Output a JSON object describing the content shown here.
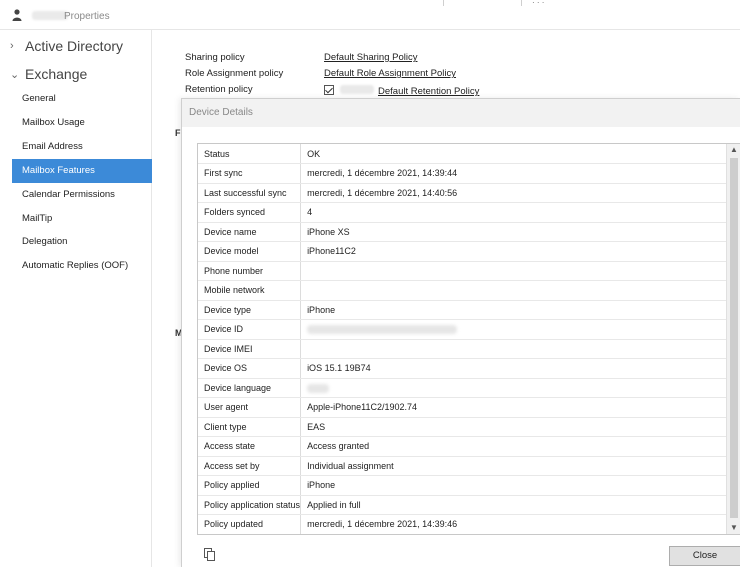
{
  "window": {
    "title": "Properties",
    "dots": "· · ·"
  },
  "nav": {
    "groups": [
      {
        "label": "Active Directory",
        "expanded": false
      },
      {
        "label": "Exchange",
        "expanded": true
      }
    ],
    "items": [
      {
        "label": "General"
      },
      {
        "label": "Mailbox Usage"
      },
      {
        "label": "Email Address"
      },
      {
        "label": "Mailbox Features",
        "selected": true
      },
      {
        "label": "Calendar Permissions"
      },
      {
        "label": "MailTip"
      },
      {
        "label": "Delegation"
      },
      {
        "label": "Automatic Replies (OOF)"
      }
    ]
  },
  "policies": {
    "sharing": {
      "label": "Sharing policy",
      "value": "Default Sharing Policy"
    },
    "role": {
      "label": "Role Assignment policy",
      "value": "Default Role Assignment Policy"
    },
    "retention": {
      "label": "Retention policy",
      "value": "Default Retention Policy",
      "checked": true
    },
    "fragments": [
      "F",
      "M"
    ]
  },
  "dialog": {
    "title": "Device Details",
    "close_label": "Close",
    "rows": [
      {
        "key": "Status",
        "value": "OK"
      },
      {
        "key": "First sync",
        "value": "mercredi, 1 décembre 2021, 14:39:44"
      },
      {
        "key": "Last successful sync",
        "value": "mercredi, 1 décembre 2021, 14:40:56"
      },
      {
        "key": "Folders synced",
        "value": "4"
      },
      {
        "key": "Device name",
        "value": "iPhone XS"
      },
      {
        "key": "Device model",
        "value": "iPhone11C2"
      },
      {
        "key": "Phone number",
        "value": ""
      },
      {
        "key": "Mobile network",
        "value": ""
      },
      {
        "key": "Device type",
        "value": "iPhone"
      },
      {
        "key": "Device ID",
        "value": "",
        "redacted": true
      },
      {
        "key": "Device IMEI",
        "value": ""
      },
      {
        "key": "Device OS",
        "value": "iOS 15.1 19B74"
      },
      {
        "key": "Device language",
        "value": "",
        "redacted": true
      },
      {
        "key": "User agent",
        "value": "Apple-iPhone11C2/1902.74"
      },
      {
        "key": "Client type",
        "value": "EAS"
      },
      {
        "key": "Access state",
        "value": "Access granted"
      },
      {
        "key": "Access set by",
        "value": "Individual assignment"
      },
      {
        "key": "Policy applied",
        "value": "iPhone"
      },
      {
        "key": "Policy application status",
        "value": "Applied in full"
      },
      {
        "key": "Policy updated",
        "value": "mercredi, 1 décembre 2021, 14:39:46"
      }
    ]
  },
  "icons": {
    "person": "person-icon",
    "copy": "copy-icon",
    "scroll_up": "▲",
    "scroll_down": "▼"
  },
  "colors": {
    "selected_bg": "#3c8ad8",
    "dialog_title_bg": "#f2f2f2"
  }
}
